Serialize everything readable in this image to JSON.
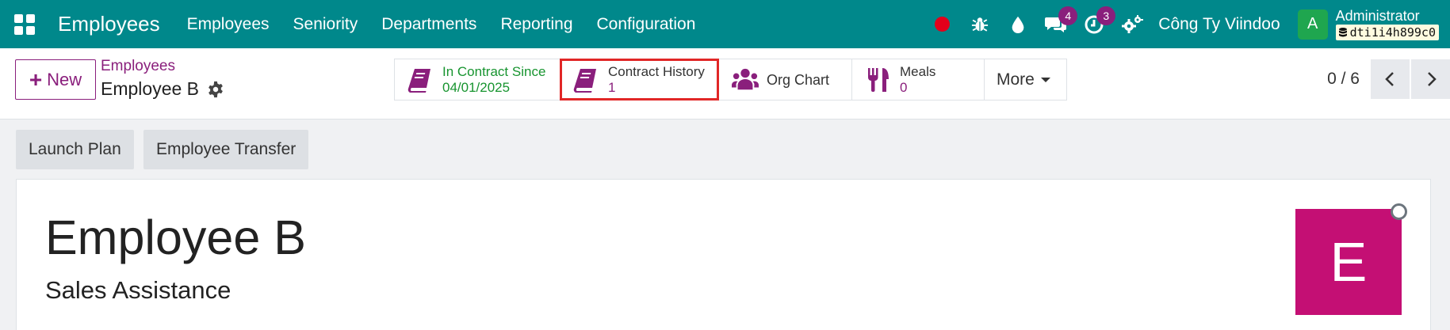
{
  "navbar": {
    "app_title": "Employees",
    "menu": [
      "Employees",
      "Seniority",
      "Departments",
      "Reporting",
      "Configuration"
    ],
    "messages_count": "4",
    "activities_count": "3",
    "company": "Công Ty Viindoo",
    "user_initial": "A",
    "user_name": "Administrator",
    "database": "dti1i4h899c0",
    "colors": {
      "bar": "#00888b",
      "badge": "#8a1f7c",
      "record": "#e3001b",
      "avatar": "#1fa64f"
    }
  },
  "control_panel": {
    "new_label": "New",
    "breadcrumb_parent": "Employees",
    "breadcrumb_current": "Employee B",
    "smart_buttons": {
      "contract_since": {
        "label": "In Contract Since",
        "value": "04/01/2025"
      },
      "contract_history": {
        "label": "Contract History",
        "value": "1"
      },
      "org_chart": {
        "label": "Org Chart"
      },
      "meals": {
        "label": "Meals",
        "value": "0"
      },
      "more": {
        "label": "More"
      }
    },
    "pager": "0 / 6"
  },
  "actions": {
    "launch_plan": "Launch Plan",
    "employee_transfer": "Employee Transfer"
  },
  "employee": {
    "name": "Employee B",
    "job_title": "Sales Assistance",
    "avatar_letter": "E",
    "avatar_color": "#c40f74"
  }
}
